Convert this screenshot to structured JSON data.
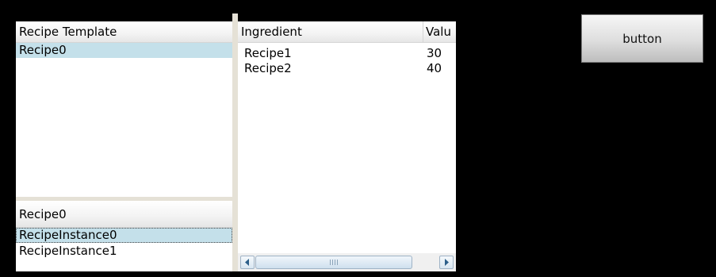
{
  "template_list": {
    "header": "Recipe Template",
    "items": [
      "Recipe0"
    ]
  },
  "instance_list": {
    "header": "Recipe0",
    "items": [
      "RecipeInstance0",
      "RecipeInstance1"
    ]
  },
  "ingredient_grid": {
    "columns": [
      "Ingredient",
      "Valu"
    ],
    "rows": [
      {
        "ingredient": "Recipe1",
        "value": "30"
      },
      {
        "ingredient": "Recipe2",
        "value": "40"
      }
    ]
  },
  "action": {
    "button_label": "button"
  },
  "colors": {
    "background": "#000000",
    "selection": "#c4e0ea",
    "panel": "#ffffff"
  },
  "icons": {
    "scroll_left": "chevron-left-icon",
    "scroll_right": "chevron-right-icon",
    "thumb_grip": "grip-icon"
  }
}
